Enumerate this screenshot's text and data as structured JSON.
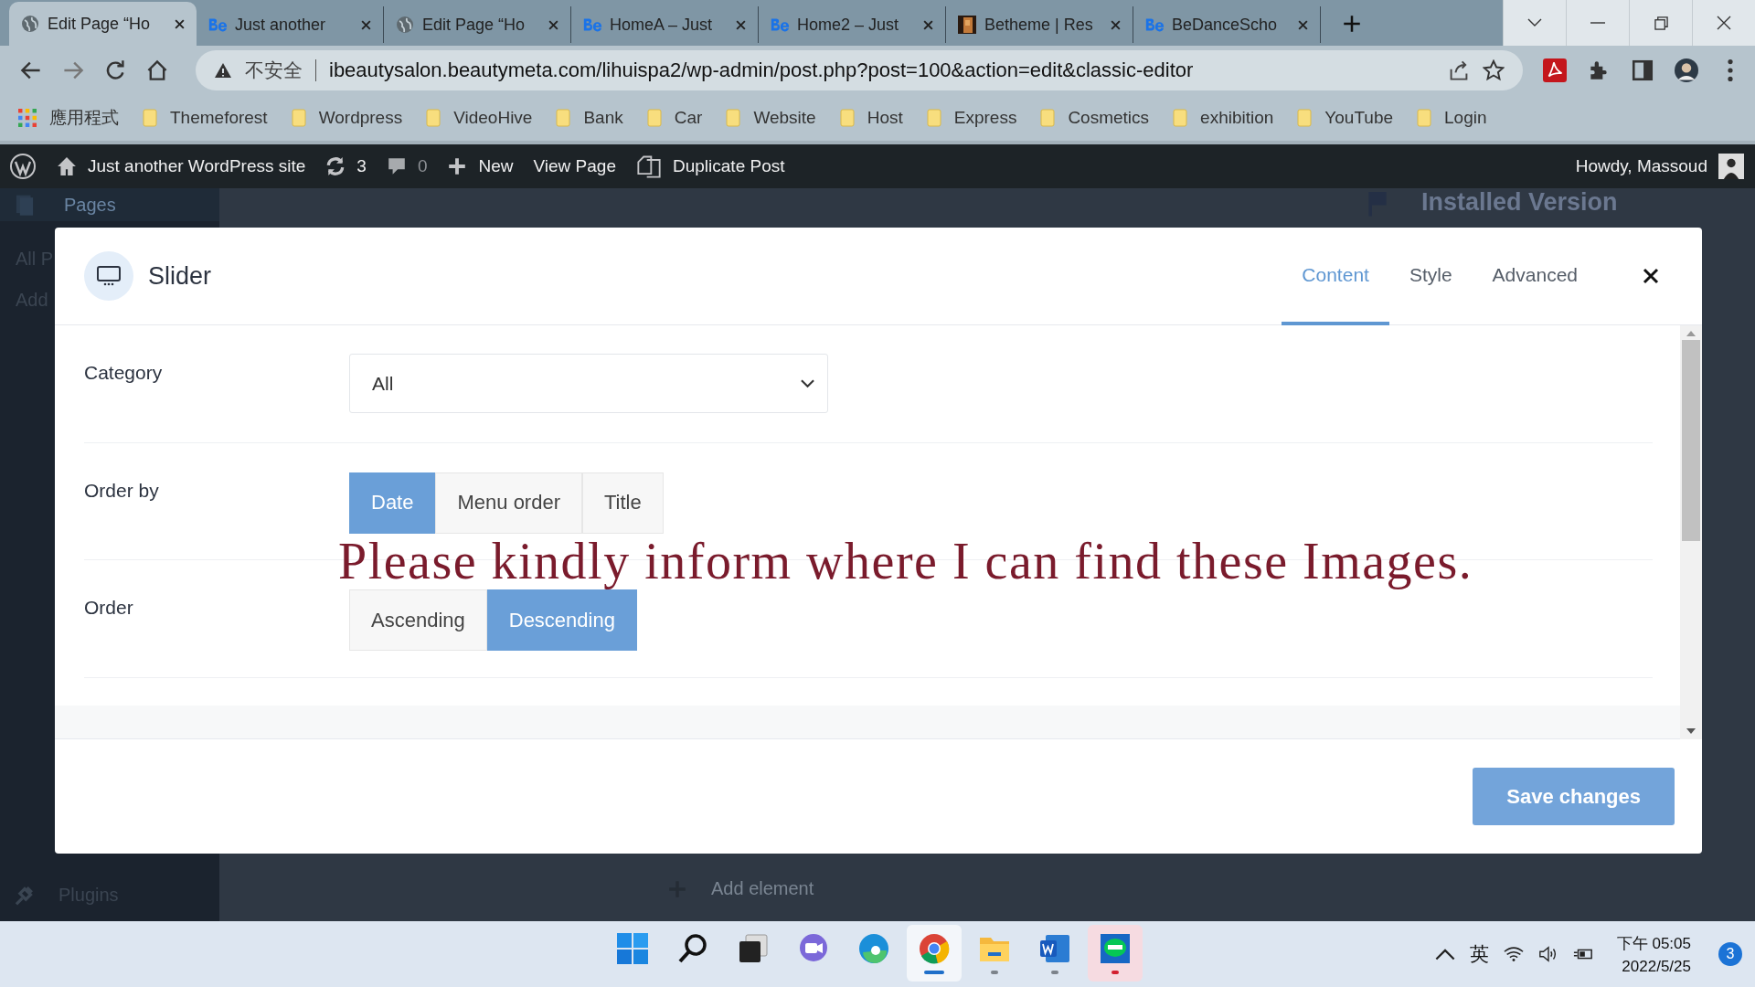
{
  "browser": {
    "tabs": [
      {
        "kind": "globe",
        "title": "Edit Page “Ho",
        "selected": true
      },
      {
        "kind": "be",
        "title": "Just another",
        "selected": false
      },
      {
        "kind": "globe",
        "title": "Edit Page “Ho",
        "selected": false
      },
      {
        "kind": "be",
        "title": "HomeA – Just",
        "selected": false
      },
      {
        "kind": "be",
        "title": "Home2 – Just",
        "selected": false
      },
      {
        "title": "Betheme | Res",
        "selected": false
      },
      {
        "kind": "be",
        "title": "BeDanceScho",
        "selected": false
      }
    ],
    "address": {
      "security": "不安全",
      "url": "ibeautysalon.beautymeta.com/lihuispa2/wp-admin/post.php?post=100&action=edit&classic-editor"
    },
    "apps": "應用程式",
    "bookmarks": [
      "Themeforest",
      "Wordpress",
      "VideoHive",
      "Bank",
      "Car",
      "Website",
      "Host",
      "Express",
      "Cosmetics",
      "exhibition",
      "YouTube",
      "Login"
    ]
  },
  "admin_bar": {
    "site": "Just another WordPress site",
    "updates": "3",
    "comments": "0",
    "new": "New",
    "view": "View Page",
    "duplicate": "Duplicate Post",
    "howdy": "Howdy, Massoud"
  },
  "background_page": {
    "menu_title": "Pages",
    "submenu": [
      "All P",
      "Add"
    ],
    "plugins": "Plugins",
    "panel_title": "Installed Version",
    "add_element": "Add element"
  },
  "modal": {
    "title": "Slider",
    "tabs": [
      {
        "label": "Content",
        "selected": true
      },
      {
        "label": "Style",
        "selected": false
      },
      {
        "label": "Advanced",
        "selected": false
      }
    ],
    "fields": [
      {
        "kind": "select",
        "label": "Category",
        "value": "All"
      },
      {
        "kind": "segmented",
        "label": "Order by",
        "options": [
          {
            "label": "Date",
            "selected": true
          },
          {
            "label": "Menu order",
            "selected": false
          },
          {
            "label": "Title",
            "selected": false
          }
        ]
      },
      {
        "kind": "segmented",
        "label": "Order",
        "options": [
          {
            "label": "Ascending",
            "selected": false
          },
          {
            "label": "Descending",
            "selected": true
          }
        ]
      }
    ],
    "save": "Save changes"
  },
  "annotation": "Please kindly inform where I can find these Images.",
  "taskbar": {
    "apps": [
      {
        "kind": "start",
        "running": false,
        "selected": false,
        "flagged": false
      },
      {
        "kind": "search",
        "running": false,
        "selected": false,
        "flagged": false
      },
      {
        "kind": "taskview",
        "running": false,
        "selected": false,
        "flagged": false
      },
      {
        "kind": "chat",
        "running": false,
        "selected": false,
        "flagged": false
      },
      {
        "kind": "edge",
        "running": false,
        "selected": false,
        "flagged": false
      },
      {
        "kind": "chrome",
        "running": true,
        "selected": true,
        "flagged": false
      },
      {
        "kind": "folder",
        "running": true,
        "selected": false,
        "flagged": false
      },
      {
        "kind": "word",
        "running": true,
        "selected": false,
        "flagged": false
      },
      {
        "kind": "line",
        "running": true,
        "selected": false,
        "flagged": true
      }
    ],
    "ime": "英",
    "time": "下午 05:05",
    "date": "2022/5/25",
    "notifications": "3"
  }
}
